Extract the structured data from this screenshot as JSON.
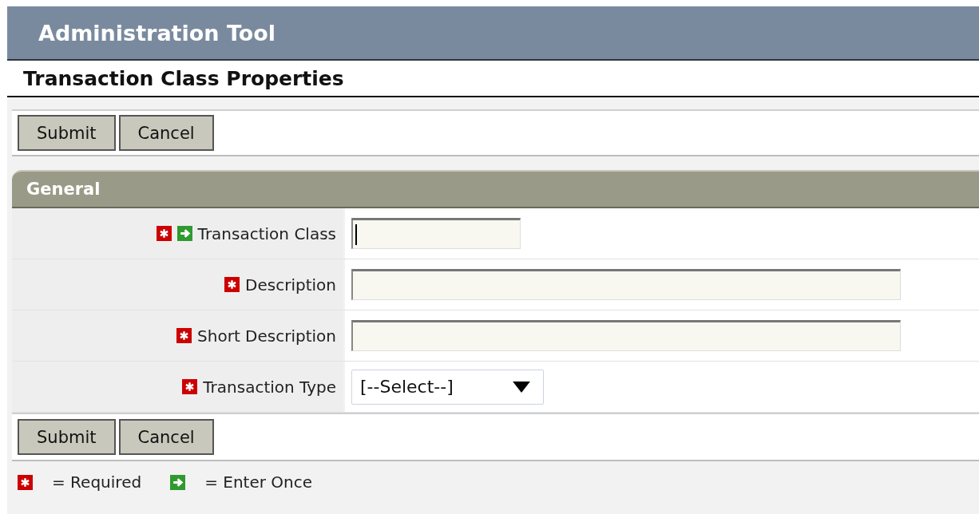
{
  "app_title": "Administration Tool",
  "page_title": "Transaction Class Properties",
  "top_buttons": [
    "Submit",
    "Cancel"
  ],
  "section": {
    "title": "General",
    "fields": [
      {
        "label": "Transaction Class",
        "kind": "short_text",
        "required": true,
        "enter_once": true,
        "focused": true
      },
      {
        "label": "Description",
        "kind": "text",
        "required": true,
        "enter_once": false,
        "focused": false
      },
      {
        "label": "Short Description",
        "kind": "text",
        "required": true,
        "enter_once": false,
        "focused": false
      },
      {
        "label": "Transaction Type",
        "kind": "select",
        "required": true,
        "enter_once": false,
        "focused": false,
        "value": "[--Select--]"
      }
    ]
  },
  "bottom_buttons": [
    "Submit",
    "Cancel"
  ],
  "legend": [
    {
      "kind": "required",
      "text": "= Required"
    },
    {
      "kind": "enter_once",
      "text": "= Enter Once"
    }
  ]
}
